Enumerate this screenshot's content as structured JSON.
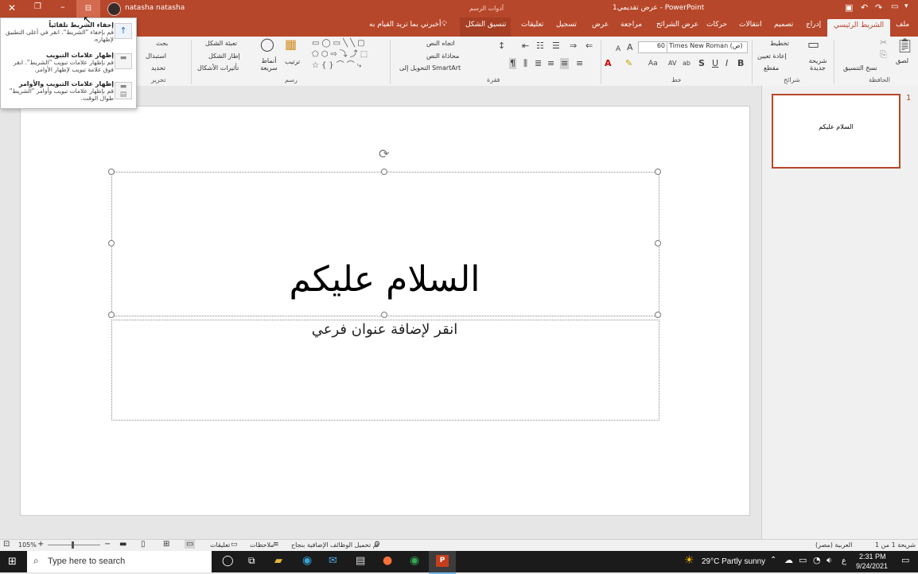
{
  "colors": {
    "accent": "#b7472a",
    "taskbar": "#1b1b1b",
    "ribbon": "#f3f3f3"
  },
  "titlebar": {
    "title": "عرض تقديمي1  -  PowerPoint",
    "context_tools": "أدوات الرسم",
    "user_name": "natasha natasha"
  },
  "tabs": {
    "file": "ملف",
    "home": "الشريط الرئيسي",
    "insert": "إدراج",
    "design": "تصميم",
    "transitions": "انتقالات",
    "animations": "حركات",
    "slideshow": "عرض الشرائح",
    "review": "مراجعة",
    "view": "عرض",
    "record": "تسجيل",
    "comments": "تعليقات",
    "shape_format": "تنسيق الشكل",
    "tell_me": "أخبرني بما تريد القيام به"
  },
  "ribbon": {
    "clipboard": {
      "label": "الحافظة",
      "paste": "لصق",
      "format_painter": "نسخ التنسيق"
    },
    "slides": {
      "label": "شرائح",
      "new_slide": "شريحة جديدة",
      "layout": "تخطيط",
      "reset": "إعادة تعيين",
      "section": "مقطع"
    },
    "font": {
      "label": "خط",
      "font_name": "Times New Roman (ص)",
      "font_size": "60",
      "bold": "B",
      "italic": "I",
      "underline": "U",
      "strike": "S",
      "shadow": "ab",
      "spacing": "AV",
      "case": "Aa",
      "grow": "A",
      "shrink": "A"
    },
    "paragraph": {
      "label": "فقرة",
      "text_direction": "اتجاه النص",
      "align_text": "محاذاة النص",
      "smartart": "التحويل إلى SmartArt"
    },
    "drawing": {
      "label": "رسم",
      "arrange": "ترتيب",
      "quick_styles": "أنماط سريعة",
      "shape_fill": "تعبئة الشكل",
      "shape_outline": "إطار الشكل",
      "shape_effects": "تأثيرات الأشكال"
    },
    "editing": {
      "label": "تحرير",
      "find": "بحث",
      "replace": "استبدال",
      "select": "تحديد"
    }
  },
  "popup": {
    "items": [
      {
        "title": "إخفاء الشريط تلقائياً",
        "desc": "قم بإخفاء \"الشريط\". انقر في أعلى التطبيق لإظهاره."
      },
      {
        "title": "إظهار علامات التبويب",
        "desc": "قم بإظهار علامات تبويب \"الشريط\". انقر فوق علامة تبويب لإظهار الأوامر."
      },
      {
        "title": "إظهار علامات التبويب والأوامر",
        "desc": "قم بإظهار علامات تبويب وأوامر \"الشريط\" طوال الوقت."
      }
    ]
  },
  "slide": {
    "title": "السلام عليكم",
    "subtitle_placeholder": "انقر لإضافة عنوان فرعي"
  },
  "thumbnails": {
    "number": "1",
    "text": "السلام عليكم"
  },
  "status": {
    "slide_count": "شريحة 1 من 1",
    "language": "العربية (مصر)",
    "addins": "تم تحميل الوظائف الإضافية بنجاح",
    "notes": "ملاحظات",
    "comments": "تعليقات",
    "zoom": "105%"
  },
  "taskbar": {
    "search_placeholder": "Type here to search",
    "weather": "29°C  Partly sunny",
    "lang": "ع",
    "time": "2:31 PM",
    "date": "9/24/2021"
  }
}
